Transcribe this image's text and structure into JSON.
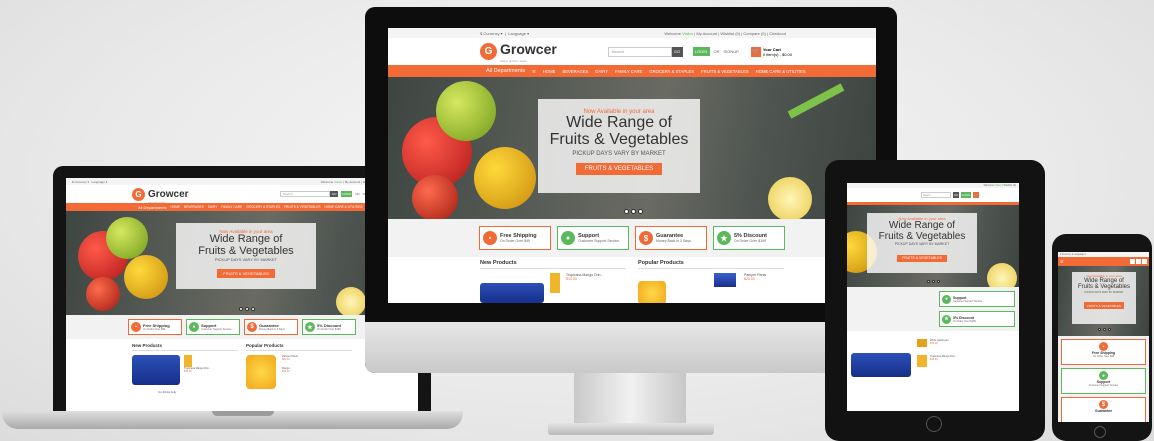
{
  "site": {
    "currency": "$ Currency",
    "language": "Language",
    "welcome": "Welcome",
    "visitor": "Visitor",
    "my_account": "My Account",
    "wishlist": "Wishlist (0)",
    "compare": "Compare (0)",
    "checkout": "Checkout",
    "brand": "Growcer",
    "tagline": "online grocery store",
    "search_placeholder": "Search",
    "search_btn": "GO",
    "login": "LOGIN",
    "or": "OR",
    "signup": "SIGNUP",
    "cart_title": "Your Cart",
    "cart_items": "0 item(s) - $0.00",
    "all_departments": "All Departments",
    "nav": [
      "HOME",
      "BEVERAGES",
      "DAIRY",
      "FAMILY CARE",
      "GROCERY & STAPLES",
      "FRUITS & VEGETABLES",
      "HOME CARE & UTILITIES"
    ],
    "hero": {
      "pre": "Now Available in your area",
      "title_line1": "Wide Range of",
      "title_line2": "Fruits & Vegetables",
      "subtitle": "PICKUP DAYS VARY BY MARKET",
      "button": "FRUITS & VEGETABLES"
    },
    "features": [
      {
        "title": "Free Shipping",
        "sub": "On Order Over $99",
        "color": "#f26a36"
      },
      {
        "title": "Support",
        "sub": "Customer Support Service",
        "color": "#5cb85c"
      },
      {
        "title": "Guarantee",
        "sub": "Money Back in 3 Days",
        "color": "#f26a36"
      },
      {
        "title": "5% Discount",
        "sub": "On Order Over $199",
        "color": "#5cb85c"
      }
    ],
    "new_products": "New Products",
    "popular_products": "Popular Products",
    "product_1_name": "Tropicana Mango Drin...",
    "product_1_price": "$15.00",
    "product_2_name": "Pamper Pants",
    "product_2_price": "$20.00",
    "product_3_name": "Mango",
    "product_3_price": "$15.00",
    "product_4_name": "Fun Drinks Kelly",
    "product_5_name": "White pastel pan",
    "product_5_price": "$15.00"
  }
}
